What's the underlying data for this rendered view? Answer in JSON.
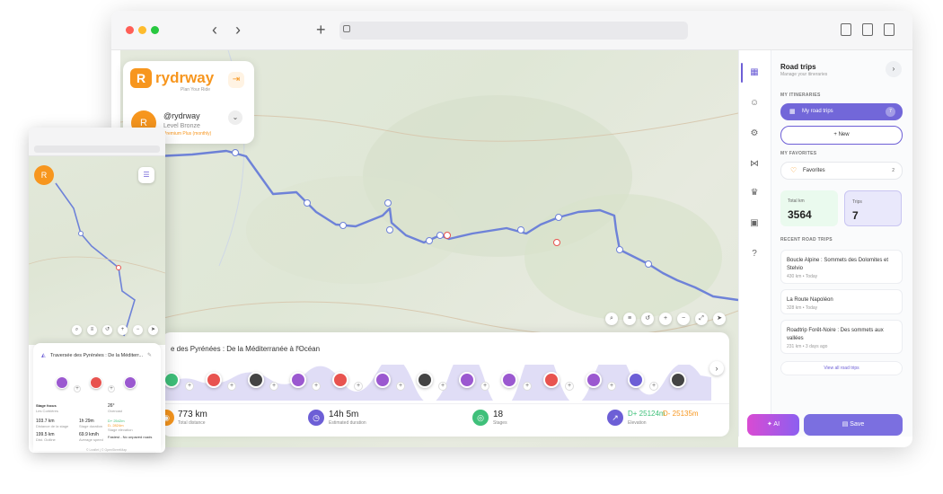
{
  "brand": {
    "logo_letter": "R",
    "name": "rydrway",
    "tagline": "Plan Your Ride",
    "accent": "#f7961e",
    "primary": "#6d5fd6"
  },
  "user": {
    "initial": "R",
    "handle": "@rydrway",
    "level": "Level Bronze",
    "plan": "Premium Plus (monthly)"
  },
  "itinerary": {
    "title": "e des Pyrénées : De la Méditerranée à l'Océan",
    "stats": [
      {
        "value": "773 km",
        "label": "Total distance",
        "color": "#f7961e"
      },
      {
        "value": "14h 5m",
        "label": "Estimated duration",
        "color": "#6d5fd6"
      },
      {
        "value": "18",
        "label": "Stages",
        "color": "#3fc07a"
      },
      {
        "value": "D+ 25124m",
        "value2": "D- 25135m",
        "label": "Elevation",
        "color": "#6d5fd6"
      }
    ],
    "markers": [
      "#3fc07a",
      "#e8534f",
      "#444444",
      "#9b59d0",
      "#e8534f",
      "#9b59d0",
      "#444444",
      "#9b59d0",
      "#9b59d0",
      "#e8534f",
      "#9b59d0",
      "#6d5fd6",
      "#444444"
    ]
  },
  "sidebar": {
    "title": "Road trips",
    "subtitle": "Manage your itineraries",
    "my_itineraries_heading": "MY ITINERARIES",
    "my_road_trips_label": "My road trips",
    "my_road_trips_count": "7",
    "new_label": "New",
    "my_favorites_heading": "MY FAVORITES",
    "favorites_label": "Favorites",
    "favorites_count": "2",
    "total_km_label": "Total km",
    "total_km_value": "3564",
    "trips_label": "Trips",
    "trips_value": "7",
    "recent_heading": "RECENT ROAD TRIPS",
    "recent": [
      {
        "title": "Boucle Alpine : Sommets des Dolomites et Stelvio",
        "meta": "430 km  •  Today"
      },
      {
        "title": "La Route Napoléon",
        "meta": "328 km  •  Today"
      },
      {
        "title": "Roadtrip Forêt-Noire : Des sommets aux vallées",
        "meta": "231 km  •  3 days ago"
      }
    ],
    "view_all_label": "View all road trips",
    "ai_label": "AI",
    "save_label": "Save"
  },
  "mobile": {
    "avatar_initial": "R",
    "sheet_title": "Traversée des Pyrénées : De la Méditerr...",
    "stage_focus_label": "Stage focus",
    "stage_focus_sub": "Les Corbières",
    "stage_km": "103.7 km",
    "stage_km_label": "Distance de la stage",
    "stage_time": "1h 29m",
    "stage_time_label": "Stage duration",
    "stage_temp": "26°",
    "stage_temp_sub": "Overcast",
    "elev_up": "D+ 2542m",
    "elev_down": "D- 2824m",
    "elev_label": "Stage elevation",
    "total_km": "199.5 km",
    "total_km_label": "Dist. Outline",
    "speed": "69.9 km/h",
    "speed_label": "Average speed",
    "fastest_label": "Fastest - No unpaved roads",
    "credits": "© Leaflet | © OpenStreetMap"
  }
}
